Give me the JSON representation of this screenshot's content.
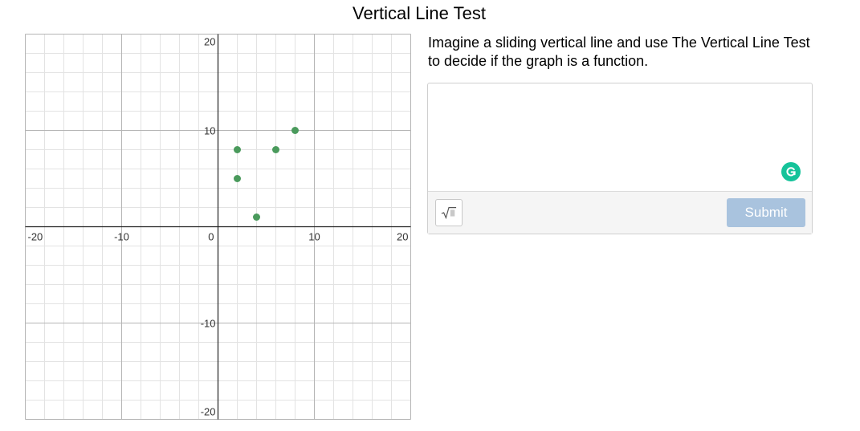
{
  "page": {
    "title": "Vertical Line Test"
  },
  "question": {
    "prompt": "Imagine a sliding vertical line and use The Vertical Line Test to decide if the graph is a function."
  },
  "answer": {
    "value": "",
    "placeholder": ""
  },
  "toolbar": {
    "submit_label": "Submit",
    "math_icon": "square-root-icon"
  },
  "icons": {
    "grammarly": "grammarly-icon"
  },
  "colors": {
    "point": "#4a9a5c",
    "submit_bg": "#a9c3de",
    "grammarly": "#15c39a"
  },
  "graph": {
    "x_range": [
      -20,
      20
    ],
    "y_range": [
      -20,
      20
    ],
    "minor_step": 2,
    "major_step": 10,
    "x_tick_labels": [
      "-20",
      "-10",
      "0",
      "10",
      "20"
    ],
    "y_tick_labels": [
      "20",
      "10",
      "-10",
      "-20"
    ],
    "points": [
      {
        "x": 2,
        "y": 8
      },
      {
        "x": 2,
        "y": 5
      },
      {
        "x": 4,
        "y": 1
      },
      {
        "x": 6,
        "y": 8
      },
      {
        "x": 8,
        "y": 10
      }
    ]
  }
}
